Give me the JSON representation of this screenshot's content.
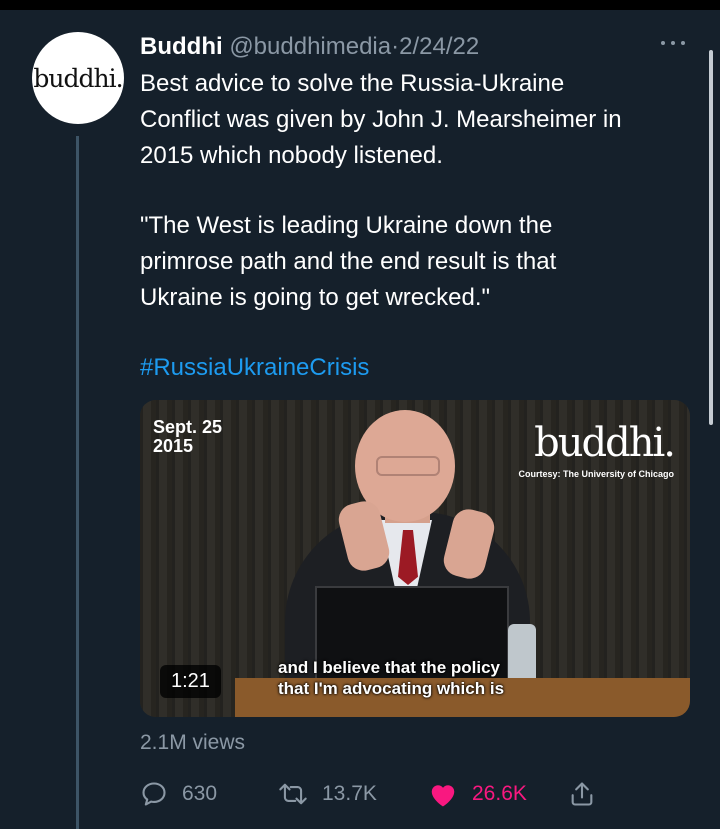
{
  "tweet": {
    "author_name": "Buddhi",
    "handle": "@buddhimedia",
    "separator": "·",
    "date": "2/24/22",
    "avatar_text": "buddhi.",
    "text_lines": [
      "Best advice to solve the Russia-Ukraine",
      "Conflict was given by John J. Mearsheimer in",
      "2015 which nobody listened."
    ],
    "quote_lines": [
      "\"The West is leading Ukraine down the",
      "primrose path and the end result is that",
      "Ukraine is going to get wrecked.\""
    ],
    "hashtag": "#RussiaUkraineCrisis",
    "video": {
      "date_line1": "Sept. 25",
      "date_line2": "2015",
      "brand": "buddhi.",
      "courtesy": "Courtesy: The University of Chicago",
      "duration": "1:21",
      "subtitle_line1": "and I believe that the policy",
      "subtitle_line2": "that I'm advocating which is"
    },
    "views": "2.1M views",
    "actions": {
      "replies": "630",
      "retweets": "13.7K",
      "likes": "26.6K"
    }
  },
  "icons": {
    "reply": "speech-bubble-icon",
    "retweet": "retweet-arrows-icon",
    "like": "heart-icon",
    "share": "share-upload-icon",
    "more": "more-dots-icon"
  },
  "colors": {
    "background": "#15202b",
    "text": "#ffffff",
    "muted": "#8b98a5",
    "link": "#1d9bf0",
    "like": "#f91880"
  }
}
